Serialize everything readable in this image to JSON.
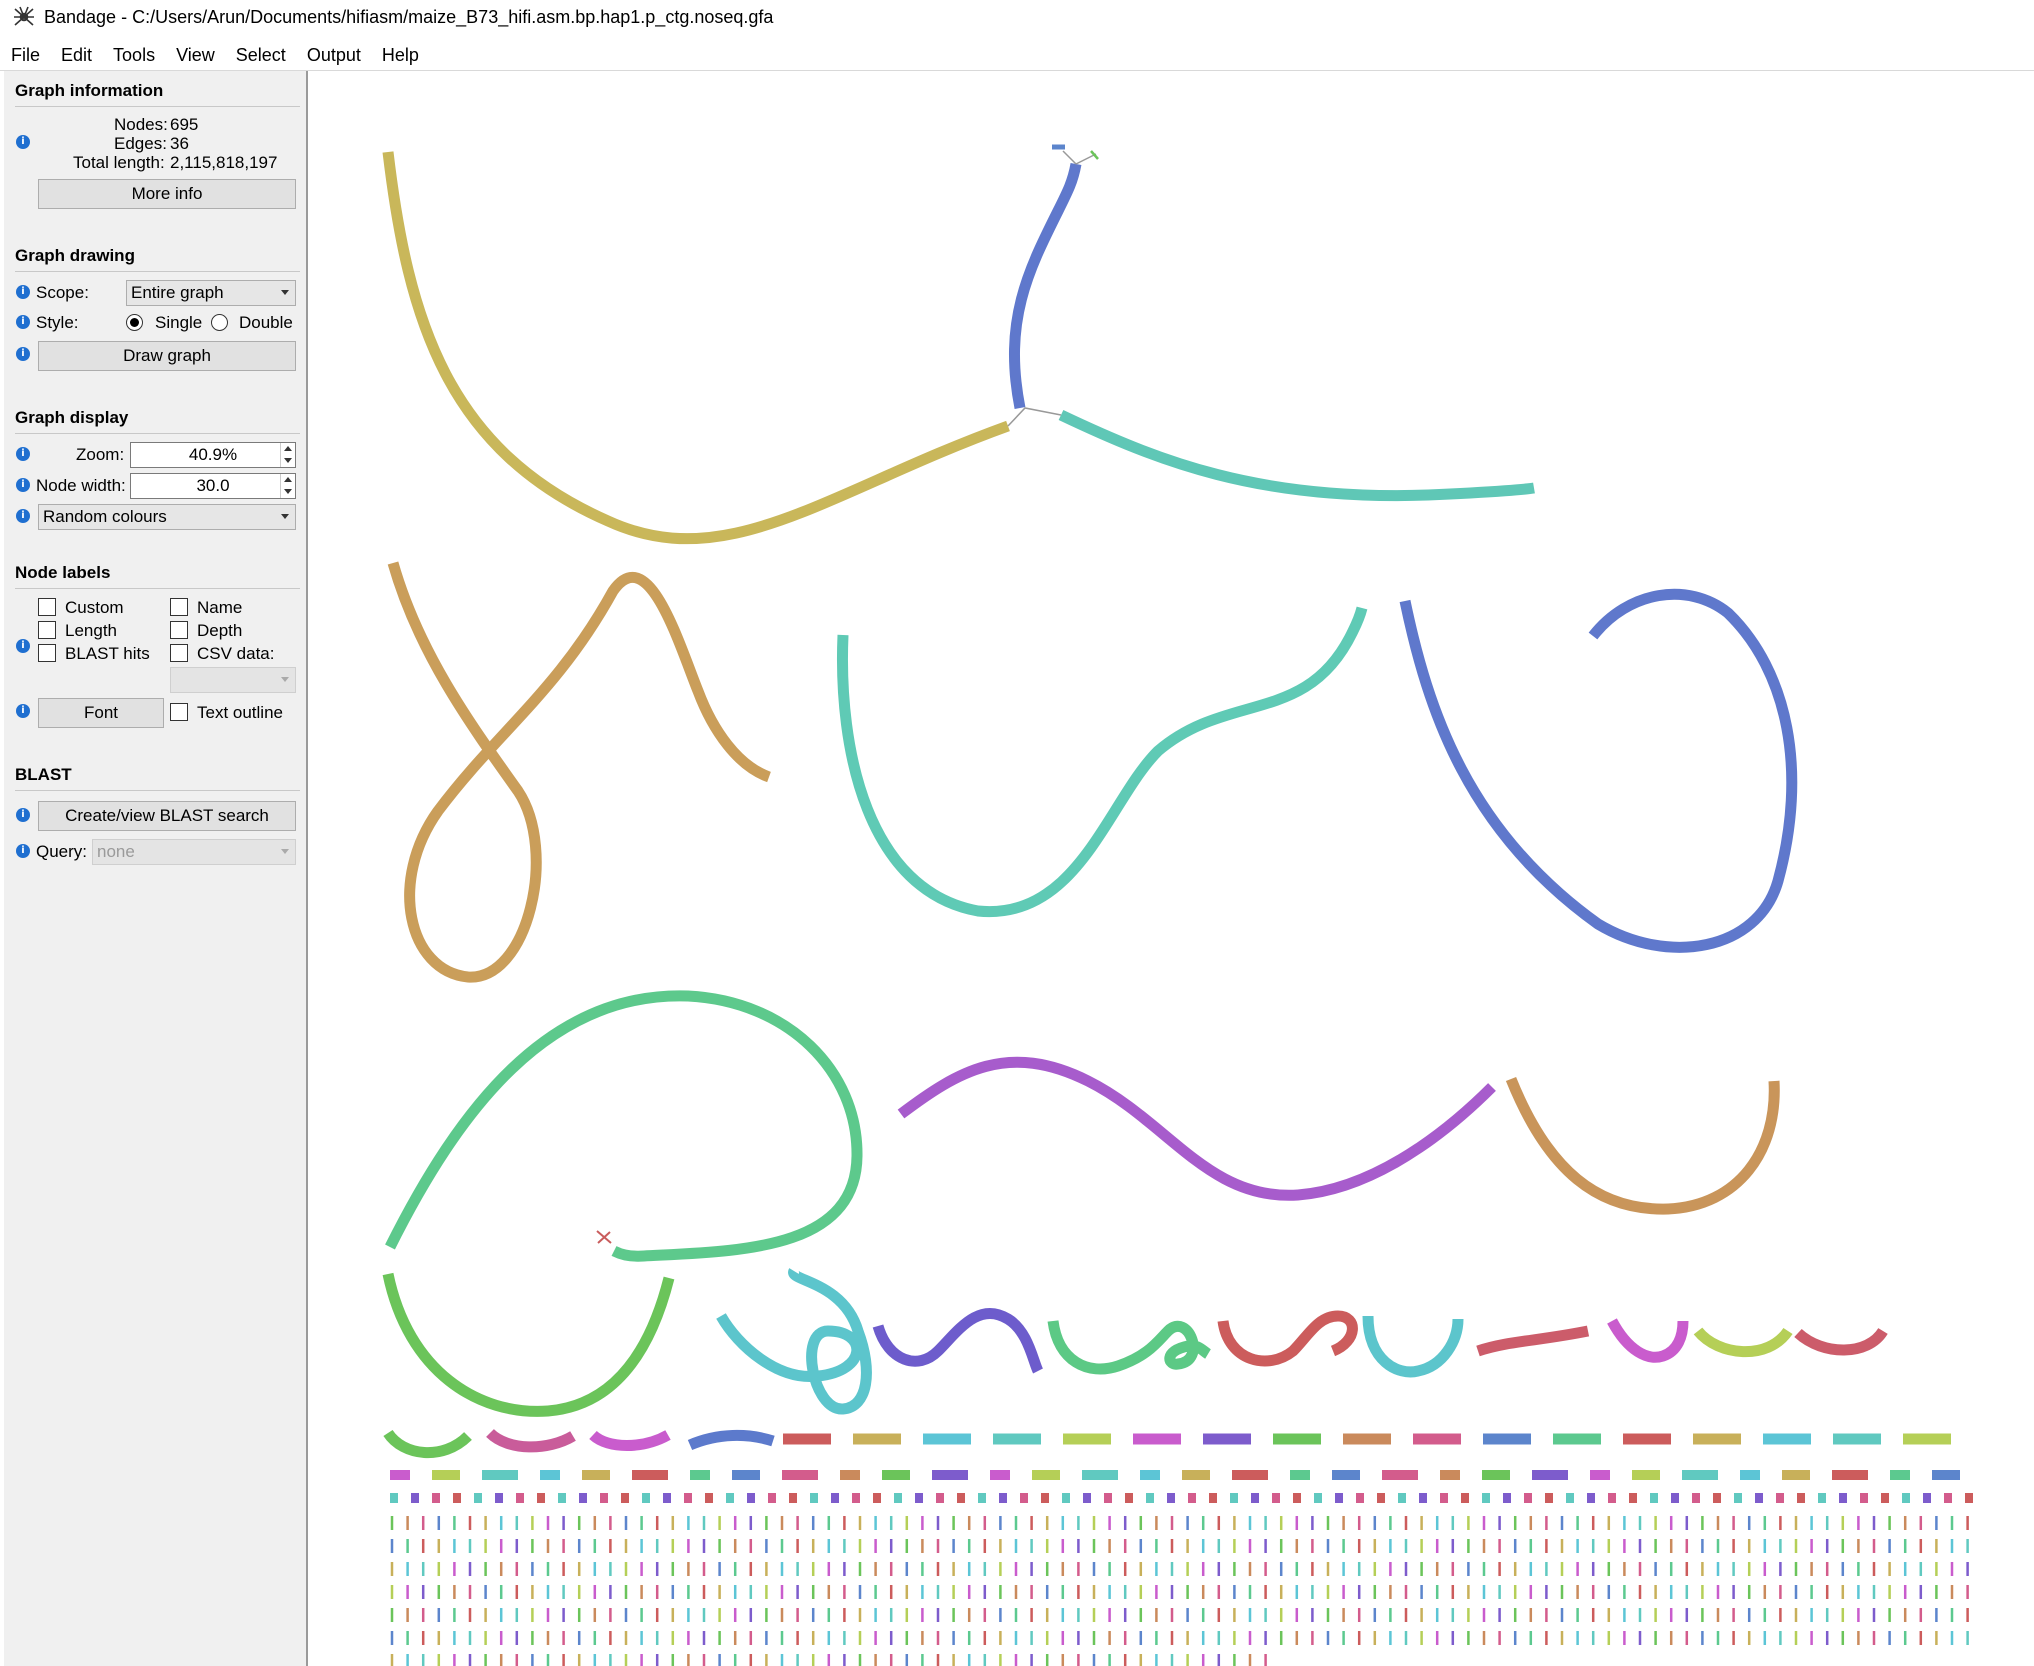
{
  "window": {
    "title": "Bandage - C:/Users/Arun/Documents/hifiasm/maize_B73_hifi.asm.bp.hap1.p_ctg.noseq.gfa",
    "icon": "bandage-spider-icon"
  },
  "menu": [
    "File",
    "Edit",
    "Tools",
    "View",
    "Select",
    "Output",
    "Help"
  ],
  "graph_information": {
    "title": "Graph information",
    "nodes_label": "Nodes:",
    "nodes_value": "695",
    "edges_label": "Edges:",
    "edges_value": "36",
    "length_label": "Total length:",
    "length_value": "2,115,818,197",
    "more_info": "More info"
  },
  "graph_drawing": {
    "title": "Graph drawing",
    "scope_label": "Scope:",
    "scope_value": "Entire graph",
    "style_label": "Style:",
    "style_single": "Single",
    "style_double": "Double",
    "style_selected": "Single",
    "draw_button": "Draw graph"
  },
  "graph_display": {
    "title": "Graph display",
    "zoom_label": "Zoom:",
    "zoom_value": "40.9%",
    "node_width_label": "Node width:",
    "node_width_value": "30.0",
    "colour_scheme": "Random colours"
  },
  "node_labels": {
    "title": "Node labels",
    "custom": "Custom",
    "name": "Name",
    "length": "Length",
    "depth": "Depth",
    "blast_hits": "BLAST hits",
    "csv_data": "CSV data:",
    "font_button": "Font",
    "text_outline": "Text outline"
  },
  "blast": {
    "title": "BLAST",
    "search_button": "Create/view BLAST search",
    "query_label": "Query:",
    "query_value": "none"
  },
  "colors": {
    "info_icon": "#1f6fd0",
    "node_colors": [
      "#6bc45a",
      "#cc5c5c",
      "#c95ccd",
      "#5c85cc",
      "#60c9c0",
      "#ca8a5c",
      "#c8b05a",
      "#7d5ccc",
      "#5cc98f",
      "#b5cf57",
      "#d35c8c",
      "#5cc5d6"
    ]
  }
}
